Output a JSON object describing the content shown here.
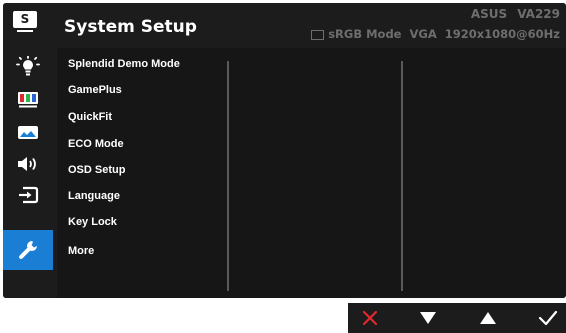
{
  "header": {
    "title": "System Setup",
    "title_icon_letter": "S",
    "brand": "ASUS",
    "model": "VA229",
    "mode": "sRGB Mode",
    "input": "VGA",
    "resolution": "1920x1080@60Hz"
  },
  "sidebar": {
    "items": [
      {
        "name": "splendid",
        "icon": "brightness-icon"
      },
      {
        "name": "color",
        "icon": "color-bars-icon"
      },
      {
        "name": "image",
        "icon": "image-icon"
      },
      {
        "name": "sound",
        "icon": "speaker-icon"
      },
      {
        "name": "input-select",
        "icon": "input-select-icon"
      },
      {
        "name": "system-setup",
        "icon": "wrench-icon",
        "active": true
      }
    ]
  },
  "menu": {
    "items": [
      "Splendid Demo Mode",
      "GamePlus",
      "QuickFit",
      "ECO Mode",
      "OSD Setup",
      "Language",
      "Key Lock",
      "More"
    ]
  },
  "nav": {
    "buttons": [
      {
        "name": "close",
        "icon": "close-icon",
        "color": "#e0282e"
      },
      {
        "name": "down",
        "icon": "arrow-down-icon",
        "color": "#ffffff"
      },
      {
        "name": "up",
        "icon": "arrow-up-icon",
        "color": "#ffffff"
      },
      {
        "name": "confirm",
        "icon": "checkmark-icon",
        "color": "#ffffff"
      }
    ]
  },
  "colors": {
    "accent": "#1a7fd4",
    "panel": "#1c1c1c",
    "muted_text": "#6e6e6e"
  }
}
